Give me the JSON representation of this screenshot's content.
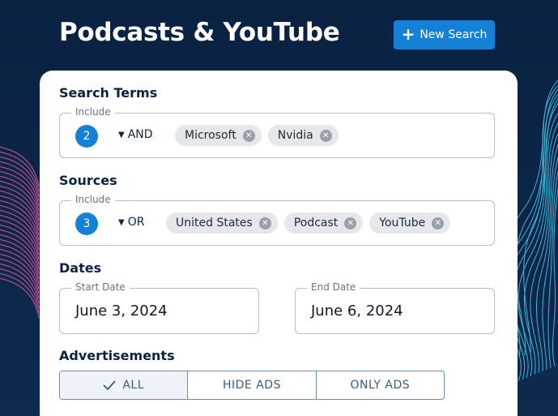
{
  "header": {
    "title": "Podcasts & YouTube",
    "new_search_label": "New Search",
    "plus_glyph": "+"
  },
  "search_terms": {
    "label": "Search Terms",
    "legend": "Include",
    "count": "2",
    "operator": "AND",
    "chips": [
      "Microsoft",
      "Nvidia"
    ]
  },
  "sources": {
    "label": "Sources",
    "legend": "Include",
    "count": "3",
    "operator": "OR",
    "chips": [
      "United States",
      "Podcast",
      "YouTube"
    ]
  },
  "dates": {
    "label": "Dates",
    "start_legend": "Start Date",
    "start_value": "June 3, 2024",
    "end_legend": "End Date",
    "end_value": "June 6, 2024"
  },
  "advertisements": {
    "label": "Advertisements",
    "options": [
      "ALL",
      "HIDE ADS",
      "ONLY ADS"
    ],
    "selected": "ALL"
  },
  "colors": {
    "background": "#0b2447",
    "accent": "#1581d6",
    "chip": "#e5e7eb"
  }
}
